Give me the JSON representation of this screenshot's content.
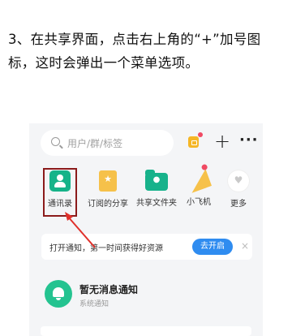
{
  "instruction": "3、在共享界面，点击右上角的“+”加号图标，这时会弹出一个菜单选项。",
  "search": {
    "placeholder": "用户/群/标签"
  },
  "header": {
    "plus": "+",
    "more": "···"
  },
  "tiles": [
    {
      "label": "通讯录",
      "icon": "contacts-icon",
      "highlighted": true
    },
    {
      "label": "订阅的分享",
      "icon": "subscription-icon"
    },
    {
      "label": "共享文件夹",
      "icon": "shared-folder-icon"
    },
    {
      "label": "小飞机",
      "icon": "paper-plane-icon"
    },
    {
      "label": "更多",
      "icon": "more-heart-icon"
    }
  ],
  "notify": {
    "text": "打开通知，第一时间获得好资源",
    "button": "去开启",
    "close": "×"
  },
  "message": {
    "title": "暂无消息通知",
    "subtitle": "系统通知"
  },
  "colors": {
    "accent": "#2f8cf0",
    "highlight_box": "#8b1b1b",
    "arrow": "#e0302a",
    "green": "#16b389"
  }
}
